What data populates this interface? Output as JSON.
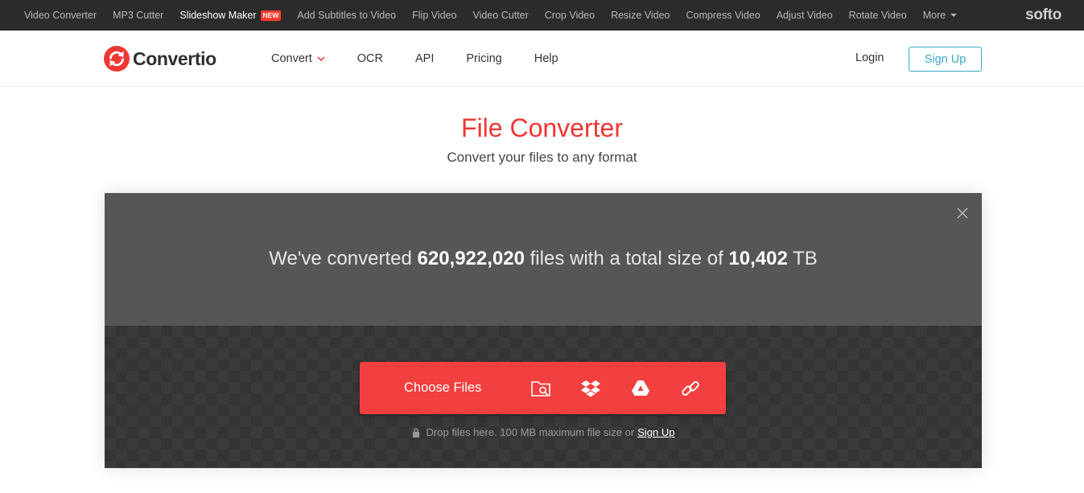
{
  "topbar": {
    "links": [
      {
        "label": "Video Converter"
      },
      {
        "label": "MP3 Cutter"
      },
      {
        "label": "Slideshow Maker",
        "badge": "NEW"
      },
      {
        "label": "Add Subtitles to Video"
      },
      {
        "label": "Flip Video"
      },
      {
        "label": "Video Cutter"
      },
      {
        "label": "Crop Video"
      },
      {
        "label": "Resize Video"
      },
      {
        "label": "Compress Video"
      },
      {
        "label": "Adjust Video"
      },
      {
        "label": "Rotate Video"
      }
    ],
    "more_label": "More",
    "brand": "softo"
  },
  "header": {
    "logo_text": "Convertio",
    "nav": [
      {
        "label": "Convert"
      },
      {
        "label": "OCR"
      },
      {
        "label": "API"
      },
      {
        "label": "Pricing"
      },
      {
        "label": "Help"
      }
    ],
    "login_label": "Login",
    "signup_label": "Sign Up"
  },
  "hero": {
    "title": "File Converter",
    "subtitle": "Convert your files to any format"
  },
  "stats": {
    "prefix": "We've converted",
    "files_count": "620,922,020",
    "middle": "files with a total size of",
    "total_size": "10,402",
    "unit": "TB"
  },
  "upload": {
    "choose_label": "Choose Files",
    "hint_text": "Drop files here. 100 MB maximum file size or",
    "hint_link": "Sign Up"
  },
  "colors": {
    "accent_red": "#ef3733",
    "signup_blue": "#3aa8c9"
  }
}
